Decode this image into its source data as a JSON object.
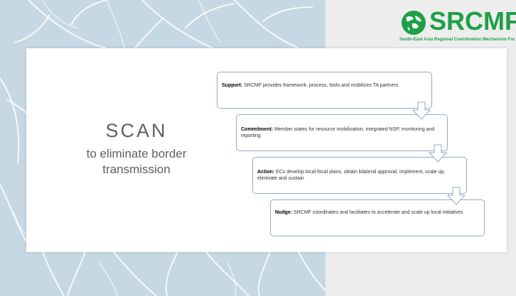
{
  "logo": {
    "name": "SRCMF",
    "tagline": "South-East Asia Regional Coordination Mechanism For",
    "color": "#1e9f47"
  },
  "slide": {
    "title": "SCAN",
    "subtitle_line1": "to eliminate border",
    "subtitle_line2": "transmission"
  },
  "steps": [
    {
      "label": "Support:",
      "text": " SRCMF provides framework, process, tools and mobilizes TA partners"
    },
    {
      "label": "Commitment:",
      "text": " Member states for resource mobilization, integrated NSP, monitoring and reporting"
    },
    {
      "label": "Action:",
      "text": " ECs develop local-focal plans, obtain bilateral approval, implement, scale up, eliminate and sustain"
    },
    {
      "label": "Nudge:",
      "text": " SRCMF coordinates and facilitates to accelerate and scale up local initiatives"
    }
  ],
  "colors": {
    "box_border": "#92a9c8",
    "background_left": "#c6d8e3",
    "text_gray": "#5f5f5f"
  }
}
